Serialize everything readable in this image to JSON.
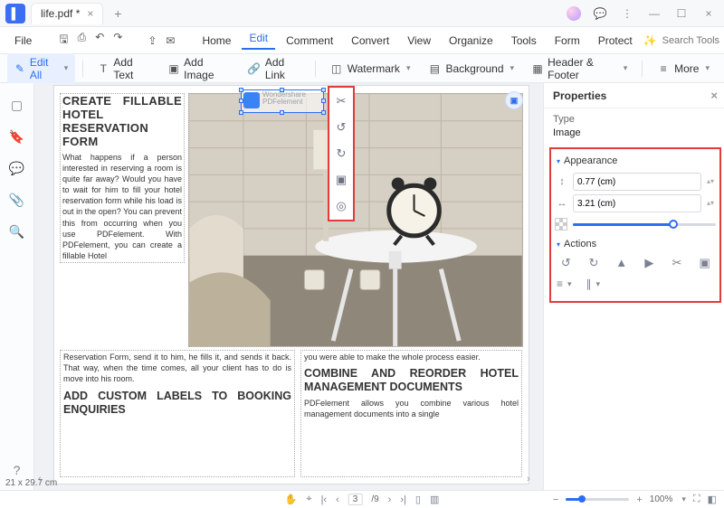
{
  "titlebar": {
    "filename": "life.pdf *"
  },
  "menu": {
    "file": "File",
    "items": [
      "Home",
      "Edit",
      "Comment",
      "Convert",
      "View",
      "Organize",
      "Tools",
      "Form",
      "Protect"
    ],
    "active_index": 1,
    "search_placeholder": "Search Tools"
  },
  "toolbar": {
    "edit_all": "Edit All",
    "add_text": "Add Text",
    "add_image": "Add Image",
    "add_link": "Add Link",
    "watermark": "Watermark",
    "background": "Background",
    "header_footer": "Header & Footer",
    "more": "More"
  },
  "doc": {
    "h1": "CREATE FILLABLE HOTEL RESERVATION FORM",
    "p1": "What happens if a person interested in reserving a room is quite far away? Would you have to wait for him to fill your hotel reservation form while his load is out in the open? You can prevent this from occurring when you use PDFelement. With PDFelement, you can create a fillable Hotel",
    "p2": "Reservation Form, send it to him, he fills it, and sends it back. That way, when the time comes, all your client has to do is move into his room.",
    "h2": "ADD CUSTOM LABELS TO BOOKING ENQUIRIES",
    "p3": "you were able to make the whole process easier.",
    "h3": "COMBINE AND REORDER HOTEL MANAGEMENT DOCUMENTS",
    "p4": "PDFelement allows you combine various hotel management documents into a single",
    "watermark_line1": "Wondershare",
    "watermark_line2": "PDFelement"
  },
  "properties": {
    "title": "Properties",
    "type_label": "Type",
    "type_value": "Image",
    "appearance": "Appearance",
    "width": "0.77 (cm)",
    "height": "3.21 (cm)",
    "actions": "Actions"
  },
  "status": {
    "dims": "21 x 29.7 cm",
    "page": "3",
    "pages": "/9",
    "zoom": "100%"
  }
}
